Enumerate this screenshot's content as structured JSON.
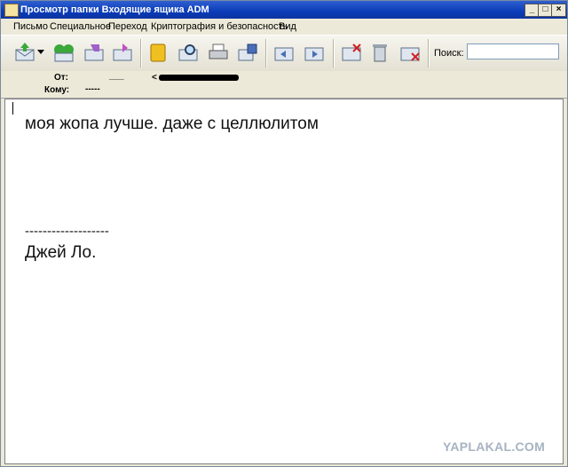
{
  "window": {
    "title": "Просмотр папки Входящие ящика ADM"
  },
  "window_controls": {
    "minimize": "_",
    "maximize": "□",
    "close": "×"
  },
  "menu": [
    "Письмо",
    "Специальное",
    "Переход",
    "Криптография и безопасность",
    "Вид"
  ],
  "toolbar": {
    "buttons": [
      "get-mail-icon",
      "dropdown-arrow-icon",
      "send-receive-icon",
      "reply-icon",
      "forward-icon",
      "address-book-icon",
      "find-icon",
      "print-icon",
      "save-icon",
      "move-icon",
      "copy-icon",
      "mark-icon",
      "delete-icon",
      "junk-icon"
    ],
    "search_label": "Поиск:",
    "search_value": ""
  },
  "header": {
    "from_label": "От:",
    "from_value": "___",
    "from_address_prefix": "<",
    "to_label": "Кому:",
    "to_value": "-----"
  },
  "message": {
    "line1": "моя жопа лучше. даже с целлюлитом",
    "line2": "-------------------",
    "line3": "Джей Ло."
  },
  "watermark": "YAPLAKAL.COM",
  "colors": {
    "titlebar": "#0a3cb8",
    "chrome": "#ece9d8",
    "body": "#ffffff"
  }
}
